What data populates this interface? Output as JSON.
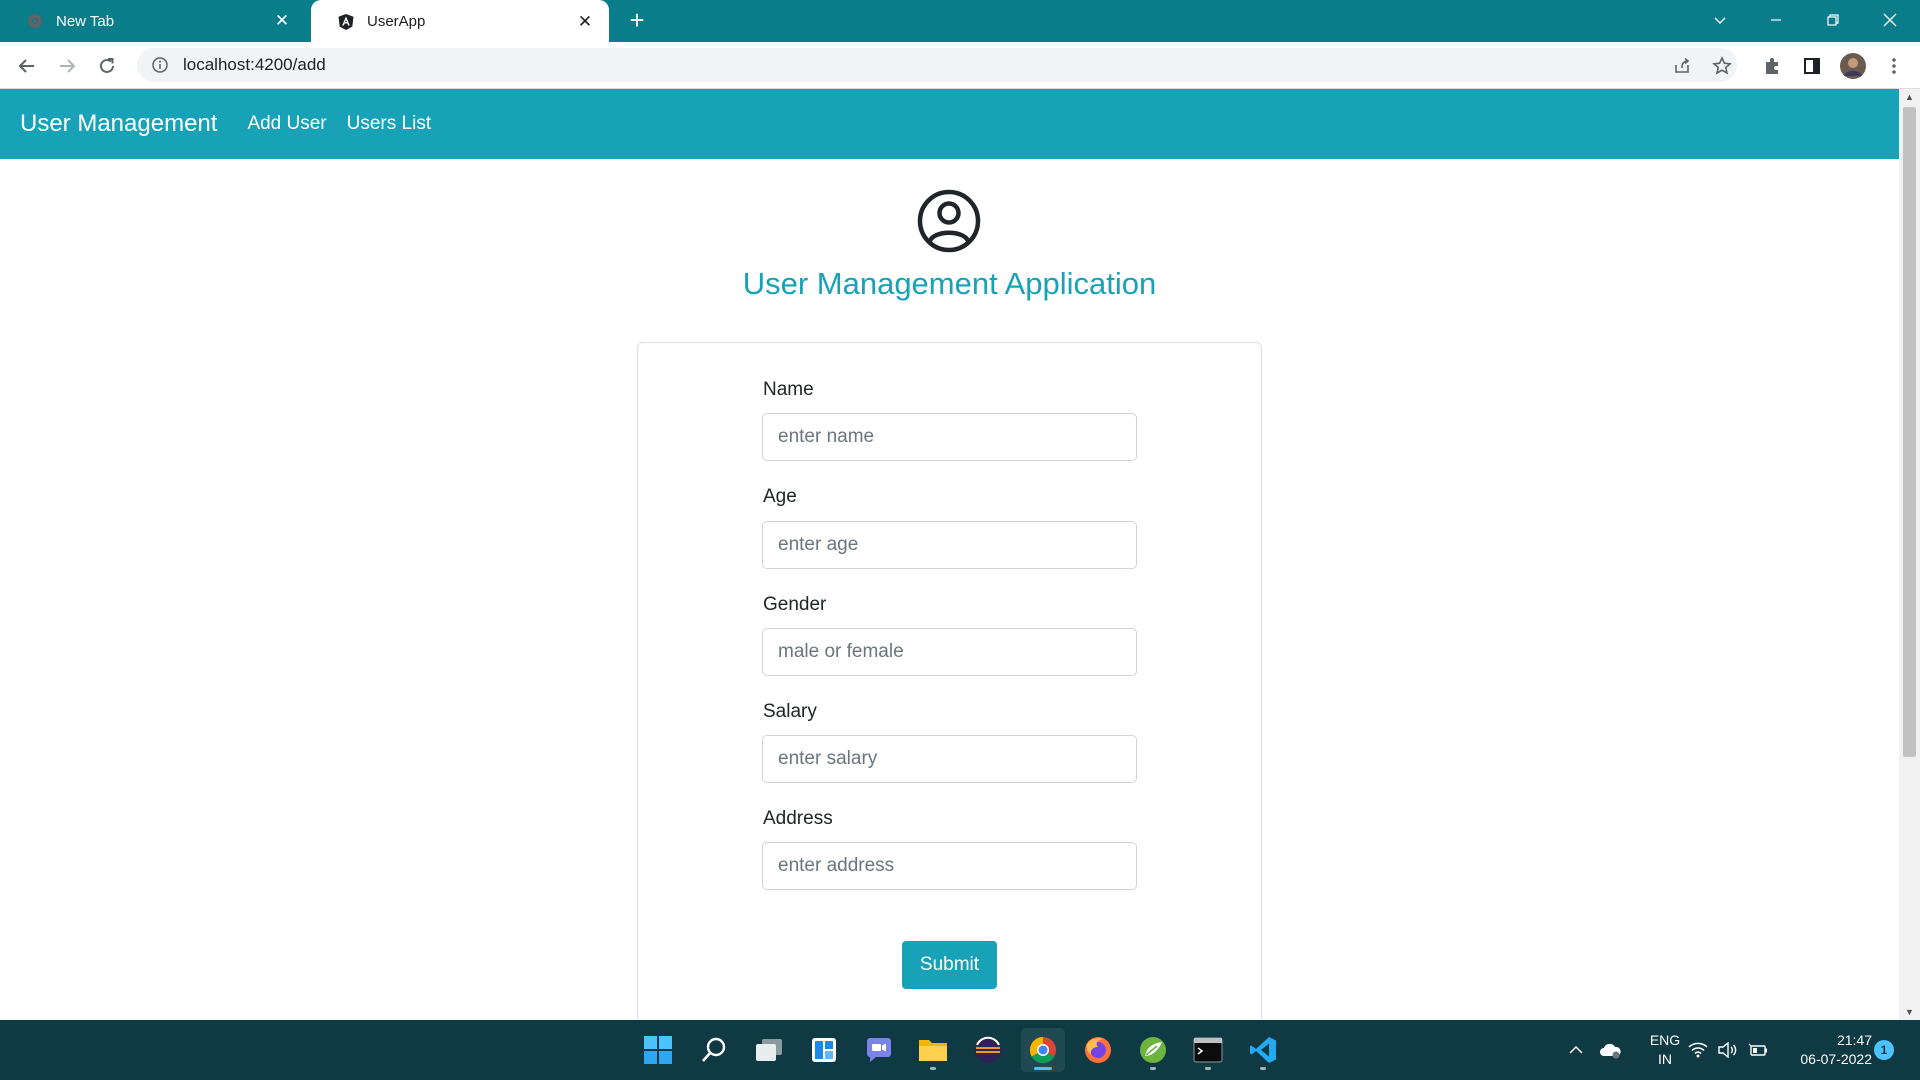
{
  "browser": {
    "tabs": [
      {
        "title": "New Tab",
        "active": false,
        "favicon": "chrome-icon"
      },
      {
        "title": "UserApp",
        "active": true,
        "favicon": "angular-icon"
      }
    ],
    "url": "localhost:4200/add"
  },
  "navbar": {
    "brand": "User Management",
    "links": [
      "Add User",
      "Users List"
    ]
  },
  "page": {
    "title": "User Management Application",
    "icon": "user-circle-icon"
  },
  "form": {
    "fields": [
      {
        "label": "Name",
        "placeholder": "enter name",
        "value": ""
      },
      {
        "label": "Age",
        "placeholder": "enter age",
        "value": ""
      },
      {
        "label": "Gender",
        "placeholder": "male or female",
        "value": ""
      },
      {
        "label": "Salary",
        "placeholder": "enter salary",
        "value": ""
      },
      {
        "label": "Address",
        "placeholder": "enter address",
        "value": ""
      }
    ],
    "submit_label": "Submit"
  },
  "taskbar": {
    "apps": [
      "start-icon",
      "search-icon",
      "task-view-icon",
      "widgets-icon",
      "teams-chat-icon",
      "file-explorer-icon",
      "eclipse-icon",
      "chrome-icon",
      "firefox-icon",
      "spring-tool-icon",
      "terminal-icon",
      "vscode-icon"
    ],
    "active_app": "chrome-icon",
    "language": "ENG",
    "region": "IN",
    "time": "21:47",
    "date": "06-07-2022",
    "notification_count": "1"
  },
  "colors": {
    "accent": "#17a2b8",
    "tabstrip": "#0a7d8a",
    "taskbar": "#0f3a44"
  }
}
